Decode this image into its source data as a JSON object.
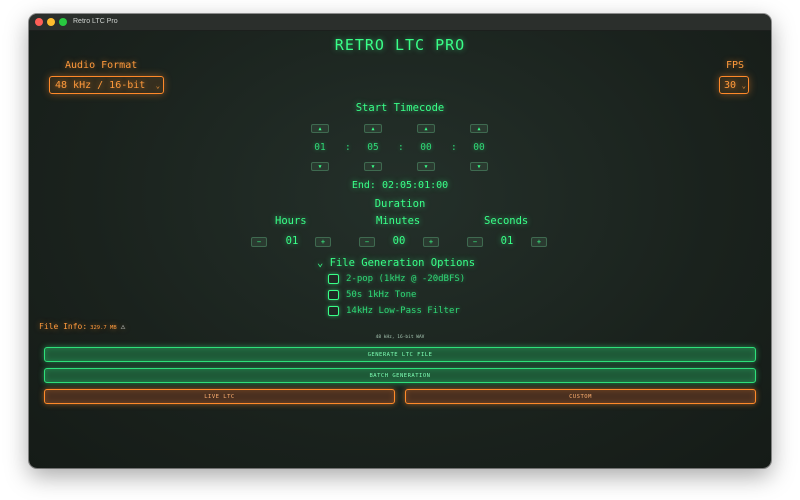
{
  "window": {
    "title": "Retro LTC Pro"
  },
  "app_title": "RETRO LTC PRO",
  "audio_format": {
    "label": "Audio Format",
    "value": "48 kHz / 16-bit"
  },
  "fps": {
    "label": "FPS",
    "value": "30"
  },
  "start_timecode": {
    "label": "Start Timecode",
    "hours": "01",
    "minutes": "05",
    "seconds": "00",
    "frames": "00",
    "separator": ":"
  },
  "end": {
    "label": "End:",
    "value": "02:05:01:00"
  },
  "duration": {
    "label": "Duration",
    "hours": {
      "label": "Hours",
      "value": "01"
    },
    "minutes": {
      "label": "Minutes",
      "value": "00"
    },
    "seconds": {
      "label": "Seconds",
      "value": "01"
    }
  },
  "file_generation": {
    "label": "File Generation Options",
    "options": [
      {
        "label": "2-pop (1kHz @ -20dBFS)",
        "checked": false
      },
      {
        "label": "50s 1kHz Tone",
        "checked": false
      },
      {
        "label": "14kHz Low-Pass Filter",
        "checked": false
      }
    ]
  },
  "file_info": {
    "label": "File Info:",
    "size": "329.7 MB"
  },
  "format_note": "48 kHz, 16-bit WAV",
  "buttons": {
    "generate": "GENERATE LTC FILE",
    "batch": "BATCH GENERATION",
    "live": "LIVE LTC",
    "custom": "CUSTOM"
  },
  "glyphs": {
    "up": "▲",
    "down": "▼",
    "minus": "−",
    "plus": "+",
    "chevron": "⌄",
    "disclosure": "⌄",
    "warning": "⚠"
  },
  "colors": {
    "green": "#39ff88",
    "orange": "#ff9a3c",
    "background": "#1a221d"
  }
}
